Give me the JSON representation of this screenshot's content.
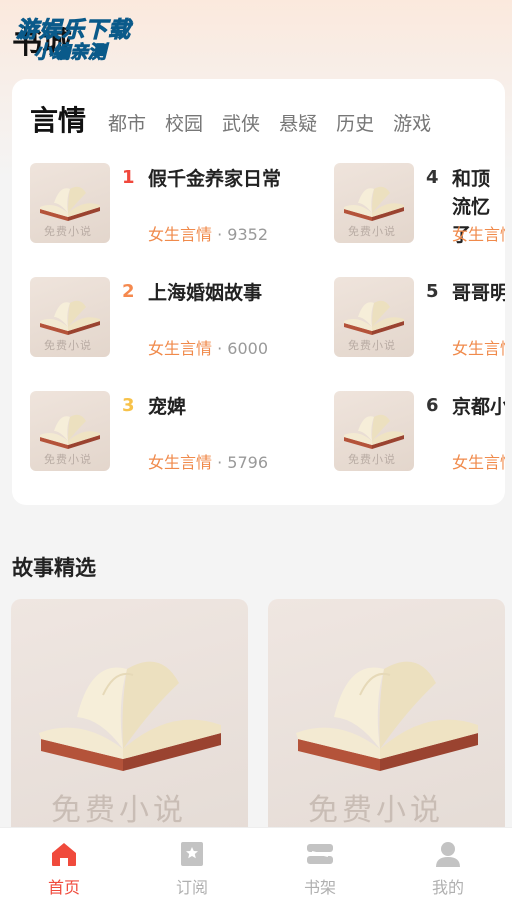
{
  "page_title": "书城",
  "watermark": {
    "line1": "游娱乐下载",
    "line2": "小编亲测"
  },
  "tabs": [
    {
      "label": "言情",
      "active": true
    },
    {
      "label": "都市"
    },
    {
      "label": "校园"
    },
    {
      "label": "武侠"
    },
    {
      "label": "悬疑"
    },
    {
      "label": "历史"
    },
    {
      "label": "游戏"
    }
  ],
  "ranking": [
    {
      "rank": "1",
      "title": "假千金养家日常",
      "category": "女生言情",
      "count": "· 9352",
      "rank_color": "#f0483c"
    },
    {
      "rank": "2",
      "title": "上海婚姻故事",
      "category": "女生言情",
      "count": "· 6000",
      "rank_color": "#f5894e"
    },
    {
      "rank": "3",
      "title": "宠婢",
      "category": "女生言情",
      "count": "· 5796",
      "rank_color": "#f7c24a"
    },
    {
      "rank": "4",
      "title": "和顶流忆了",
      "category": "女生言情",
      "count": "",
      "rank_color": "#333333"
    },
    {
      "rank": "5",
      "title": "哥哥明",
      "category": "女生言情",
      "count": "",
      "rank_color": "#333333"
    },
    {
      "rank": "6",
      "title": "京都小",
      "category": "女生言情",
      "count": "",
      "rank_color": "#333333"
    }
  ],
  "cover_text": "免费小说",
  "section_title": "故事精选",
  "bottom_nav": [
    {
      "label": "首页",
      "icon": "home-icon",
      "active": true
    },
    {
      "label": "订阅",
      "icon": "bookmark-icon"
    },
    {
      "label": "书架",
      "icon": "bookshelf-icon"
    },
    {
      "label": "我的",
      "icon": "profile-icon"
    }
  ],
  "colors": {
    "accent": "#f04a3c",
    "category": "#f08a4b"
  }
}
